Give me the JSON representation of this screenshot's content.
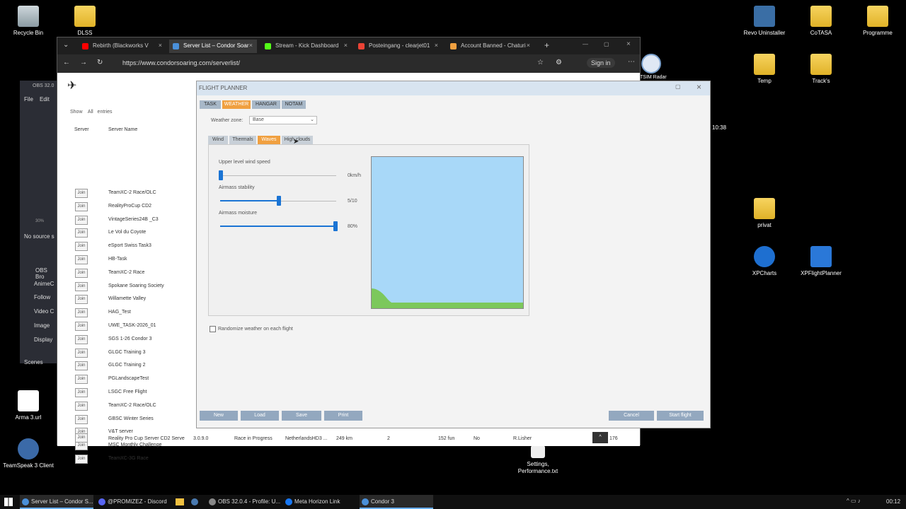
{
  "desktop": {
    "icons": [
      {
        "label": "Recycle Bin"
      },
      {
        "label": "DLSS"
      },
      {
        "label": "Revo Uninstaller"
      },
      {
        "label": "CoTASA"
      },
      {
        "label": "Programme"
      },
      {
        "label": "Temp"
      },
      {
        "label": "Track's"
      },
      {
        "label": "privat"
      },
      {
        "label": "XPCharts"
      },
      {
        "label": "XPFlightPlanner"
      },
      {
        "label": "Arma 3.url"
      },
      {
        "label": "TeamSpeak 3 Client"
      },
      {
        "label": "Settings, Performance.txt"
      }
    ]
  },
  "browser": {
    "tabs": [
      {
        "label": "Rebirth (Blackworks V",
        "icon": "youtube-icon",
        "color": "#ff0000"
      },
      {
        "label": "Server List – Condor Soar",
        "icon": "condor-icon",
        "color": "#4a90d9"
      },
      {
        "label": "Stream - Kick Dashboard",
        "icon": "kick-icon",
        "color": "#53fc18"
      },
      {
        "label": "Posteingang - clearjet01",
        "icon": "gmail-icon",
        "color": "#ea4335"
      },
      {
        "label": "Account Banned - Chaturi",
        "icon": "site-icon",
        "color": "#f0a040"
      }
    ],
    "url": "https://www.condorsoaring.com/serverlist/",
    "sign_in": "Sign in"
  },
  "server_list": {
    "show_label": "Show",
    "show_value": "All",
    "entries_label": "entries",
    "col_server": "Server",
    "col_name": "Server Name",
    "join_label": "Join",
    "rows": [
      "TeamXC-2 Race/OLC",
      "RealityProCup CD2",
      "VintageSeries24B _C3",
      "Le Vol du Coyote",
      "eSport Swiss Task3",
      "HB-Task",
      "TeamXC-2 Race",
      "Spokane Soaring Society",
      "Willamette Valley",
      "HAG_Test",
      "UWE_TASK-2026_01",
      "SGS 1-26 Condor 3",
      "GLGC Training 3",
      "GLGC Training 2",
      "PGLandscapeTest",
      "LSGC Free Flight",
      "TeamXC-2 Race/OLC",
      "GBSC Winter Series",
      "V&T server",
      "MSC Monthly Challenge",
      "TeamXC-3G Race"
    ],
    "last_row": {
      "name": "Reality Pro Cup Server CD2 Serve",
      "version": "3.0.9.0",
      "status": "Race in Progress",
      "landscape": "NetherlandsHD3 ...",
      "distance": "249 km",
      "players": "2",
      "max": "152 fun",
      "pw": "No",
      "host": "R.Lisher",
      "ping": "176"
    }
  },
  "obs": {
    "title": "OBS 32.0",
    "menu_file": "File",
    "menu_edit": "Edit",
    "no_source": "No source s",
    "zoom": "30%",
    "docks": [
      "OBS Bro",
      "AnimeC",
      "Follow",
      "Video C",
      "Image",
      "Display"
    ],
    "scenes_label": "Scenes"
  },
  "flight_planner": {
    "title": "FLIGHT PLANNER",
    "tabs": [
      "TASK",
      "WEATHER",
      "HANGAR",
      "NOTAM"
    ],
    "active_tab": "WEATHER",
    "weather_zone_label": "Weather zone:",
    "weather_zone_value": "Base",
    "subtabs": [
      "Wind",
      "Thermals",
      "Waves",
      "High clouds"
    ],
    "active_subtab": "Waves",
    "sliders": [
      {
        "label": "Upper level wind speed",
        "value_text": "0km/h",
        "value": 0.0
      },
      {
        "label": "Airmass stability",
        "value_text": "5/10",
        "value": 0.5
      },
      {
        "label": "Airmass moisture",
        "value_text": "80%",
        "value": 1.0
      }
    ],
    "randomize_label": "Randomize weather on each flight",
    "randomize_checked": false,
    "buttons": {
      "new": "New",
      "load": "Load",
      "save": "Save",
      "print": "Print",
      "cancel": "Cancel",
      "start": "Start flight"
    },
    "colors": {
      "sky": "#a8d8f8",
      "ground": "#7cc85c",
      "accent": "#f0a040"
    }
  },
  "taskbar": {
    "items": [
      {
        "label": "Server List – Condor S...",
        "color": "#4a90d9"
      },
      {
        "label": "@PROMIZEZ - Discord",
        "color": "#5865f2"
      },
      {
        "label": "OBS 32.0.4 - Profile: U...",
        "color": "#888888"
      },
      {
        "label": "Meta Horizon Link",
        "color": "#1877f2"
      },
      {
        "label": "Condor 3",
        "color": "#4a90d9"
      }
    ],
    "time": "00:12"
  },
  "overlay": {
    "side_text": "10:38",
    "tsim": "TSIM Radar"
  }
}
